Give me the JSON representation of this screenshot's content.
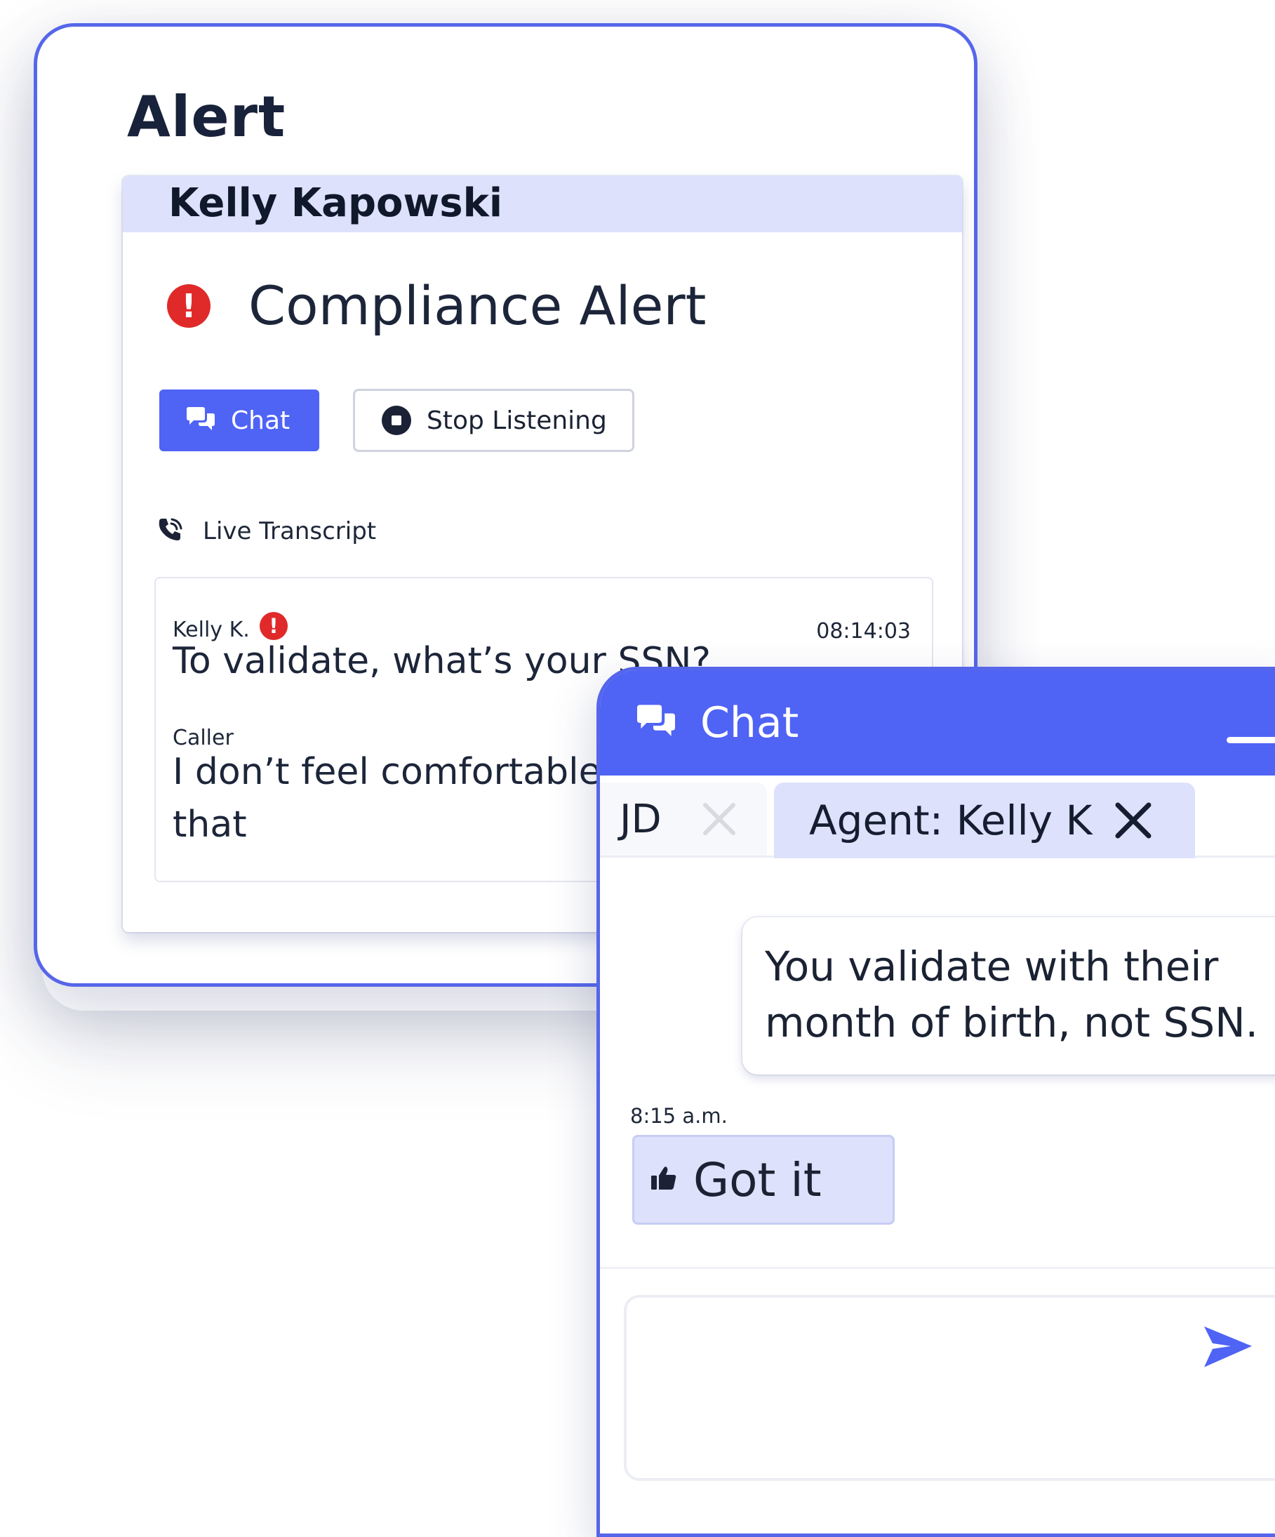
{
  "alert_window": {
    "title": "Alert",
    "agent_name": "Kelly Kapowski",
    "alert_label": "Compliance Alert",
    "chat_button_label": "Chat",
    "stop_button_label": "Stop Listening",
    "live_transcript_label": "Live Transcript",
    "transcript": [
      {
        "speaker": "Kelly K.",
        "flagged": true,
        "timestamp": "08:14:03",
        "text": "To validate, what’s your SSN?"
      },
      {
        "speaker": "Caller",
        "flagged": false,
        "text_line1": "I don’t feel comfortable w",
        "text_line2": "that"
      }
    ]
  },
  "chat_window": {
    "title": "Chat",
    "tabs": [
      {
        "label": "JD",
        "active": false
      },
      {
        "label": "Agent: Kelly K",
        "active": true
      }
    ],
    "message": "You validate with their\nmonth of birth, not SSN.",
    "time": "8:15 a.m.",
    "reply": "Got it",
    "compose_placeholder": ""
  },
  "colors": {
    "accent": "#4f63f5",
    "accent_light": "#dde1fb",
    "alert_red": "#e02a2a",
    "text_dark": "#1a2233",
    "border": "#5666ea"
  },
  "icons": {
    "alert": "exclamation-circle-icon",
    "chat": "chat-bubbles-icon",
    "stop": "stop-circle-icon",
    "phone": "phone-wave-icon",
    "close": "close-icon",
    "thumbs_up": "thumbs-up-icon",
    "send": "send-icon",
    "minimize": "minimize-icon"
  }
}
